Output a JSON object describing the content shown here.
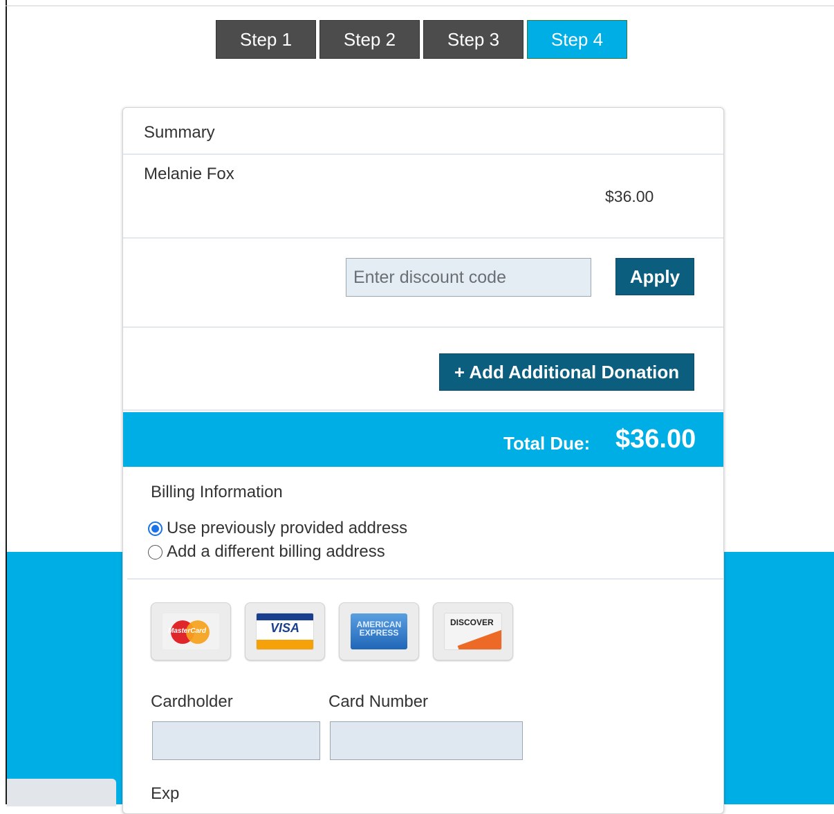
{
  "steps": [
    {
      "label": "Step 1",
      "active": false
    },
    {
      "label": "Step 2",
      "active": false
    },
    {
      "label": "Step 3",
      "active": false
    },
    {
      "label": "Step 4",
      "active": true
    }
  ],
  "summary": {
    "title": "Summary",
    "items": [
      {
        "name": "Melanie Fox",
        "amount": "$36.00"
      }
    ]
  },
  "discount": {
    "placeholder": "Enter discount code",
    "value": "",
    "apply_label": "Apply"
  },
  "donation": {
    "button_label": "+ Add Additional Donation"
  },
  "total": {
    "label": "Total Due:",
    "value": "$36.00"
  },
  "billing": {
    "title": "Billing Information",
    "options": [
      {
        "label": "Use previously provided address",
        "selected": true
      },
      {
        "label": "Add a different billing address",
        "selected": false
      }
    ]
  },
  "card_types": [
    {
      "name": "mastercard-icon",
      "text": "MasterCard"
    },
    {
      "name": "visa-icon",
      "text": "VISA"
    },
    {
      "name": "amex-icon",
      "text": "AMERICAN EXPRESS"
    },
    {
      "name": "discover-icon",
      "text": "DISCOVER"
    }
  ],
  "payment_fields": {
    "cardholder_label": "Cardholder",
    "cardholder_value": "",
    "card_number_label": "Card Number",
    "card_number_value": "",
    "exp_label": "Exp"
  },
  "colors": {
    "accent": "#00aee6",
    "button": "#0b5e7e",
    "step_inactive": "#4c4c4c"
  }
}
